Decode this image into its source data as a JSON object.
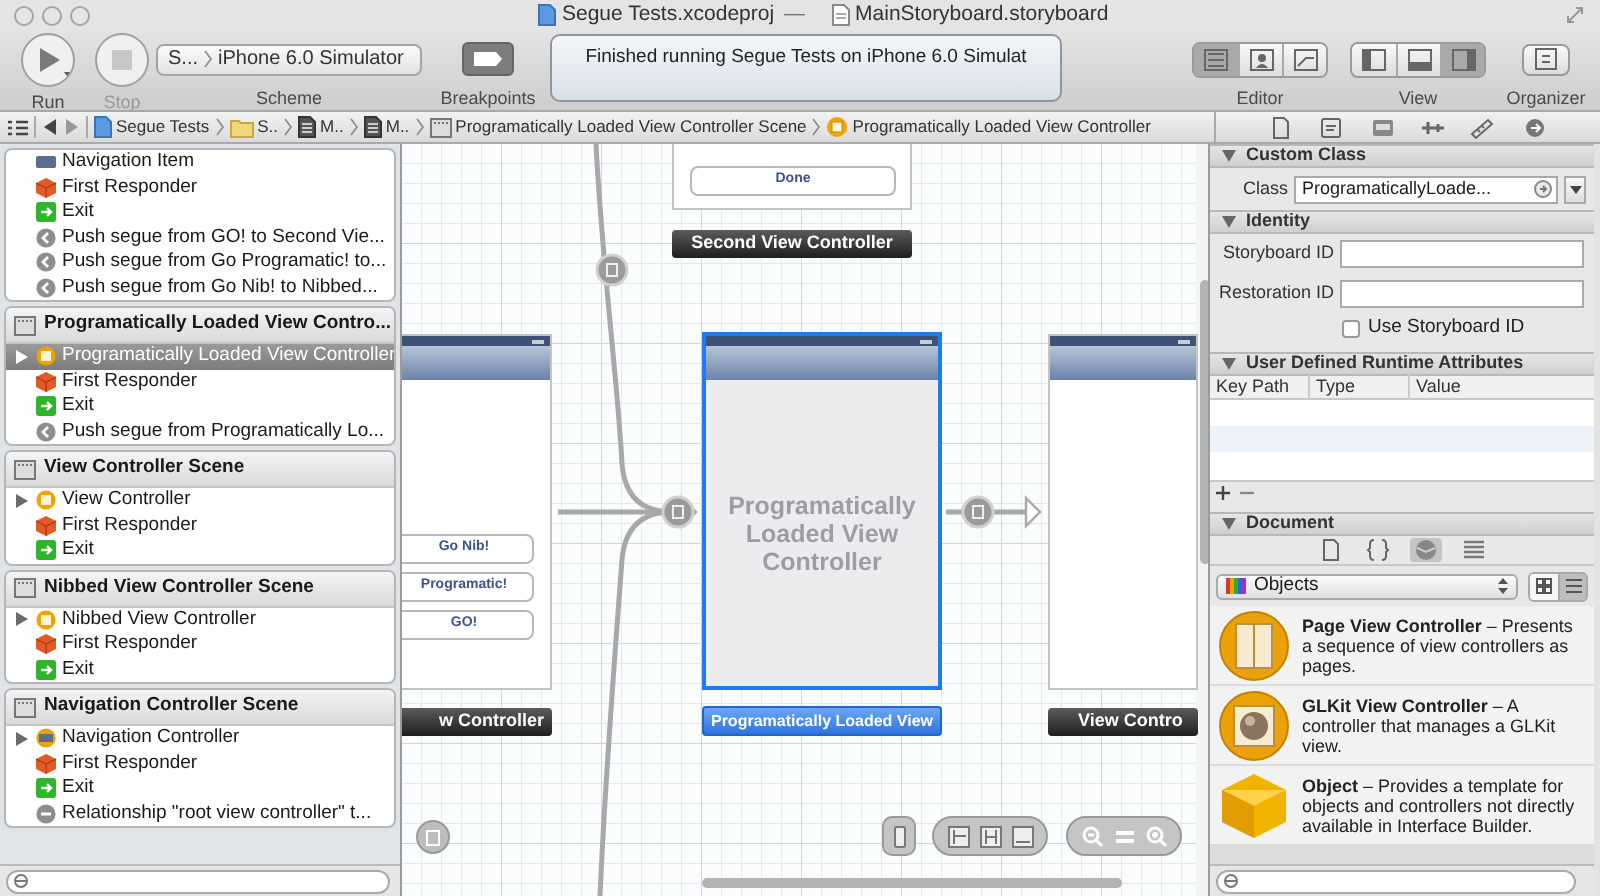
{
  "window": {
    "project_title": "Segue Tests.xcodeproj",
    "separator": "—",
    "document_title": "MainStoryboard.storyboard"
  },
  "toolbar": {
    "run": {
      "label": "Run",
      "disabled": false
    },
    "stop": {
      "label": "Stop",
      "disabled": true
    },
    "scheme": {
      "label": "Scheme",
      "target": "S...",
      "destination": "iPhone 6.0 Simulator"
    },
    "breakpoints": {
      "label": "Breakpoints"
    },
    "activity": "Finished running Segue Tests on iPhone 6.0 Simulat",
    "editor": {
      "label": "Editor",
      "modes": [
        {
          "kind": "standard",
          "selected": true
        },
        {
          "kind": "assistant",
          "selected": false
        },
        {
          "kind": "version",
          "selected": false
        }
      ]
    },
    "view": {
      "label": "View",
      "panes": [
        {
          "kind": "navigator",
          "selected": false
        },
        {
          "kind": "debug",
          "selected": false
        },
        {
          "kind": "utilities",
          "selected": true
        }
      ]
    },
    "organizer": {
      "label": "Organizer"
    }
  },
  "jump_bar": [
    {
      "kind": "project",
      "text": "Segue Tests"
    },
    {
      "kind": "folder",
      "text": "S.."
    },
    {
      "kind": "file",
      "text": "M.."
    },
    {
      "kind": "file",
      "text": "M.."
    },
    {
      "kind": "scene",
      "text": "Programatically Loaded View Controller Scene"
    },
    {
      "kind": "controller",
      "text": "Programatically Loaded View Controller"
    }
  ],
  "inspector_tabs": [
    {
      "kind": "file"
    },
    {
      "kind": "quick-help"
    },
    {
      "kind": "identity"
    },
    {
      "kind": "attributes"
    },
    {
      "kind": "size"
    },
    {
      "kind": "connections"
    }
  ],
  "outline": [
    {
      "items": [
        {
          "kind": "navigation-item",
          "label": "Navigation Item",
          "expandable": false,
          "selected": false
        },
        {
          "kind": "first-responder",
          "label": "First Responder",
          "expandable": false,
          "selected": false
        },
        {
          "kind": "exit",
          "label": "Exit",
          "expandable": false,
          "selected": false
        },
        {
          "kind": "segue",
          "label": "Push segue from GO! to Second Vie...",
          "expandable": false,
          "selected": false
        },
        {
          "kind": "segue",
          "label": "Push segue from Go Programatic! to...",
          "expandable": false,
          "selected": false
        },
        {
          "kind": "segue",
          "label": "Push segue from Go Nib! to Nibbed...",
          "expandable": false,
          "selected": false
        }
      ]
    },
    {
      "title": "Programatically Loaded View Contro...",
      "items": [
        {
          "kind": "view-controller",
          "label": "Programatically Loaded View Controller",
          "expandable": true,
          "selected": true
        },
        {
          "kind": "first-responder",
          "label": "First Responder",
          "expandable": false,
          "selected": false
        },
        {
          "kind": "exit",
          "label": "Exit",
          "expandable": false,
          "selected": false
        },
        {
          "kind": "segue",
          "label": "Push segue from Programatically Lo...",
          "expandable": false,
          "selected": false
        }
      ]
    },
    {
      "title": "View Controller Scene",
      "items": [
        {
          "kind": "view-controller",
          "label": "View Controller",
          "expandable": true,
          "selected": false
        },
        {
          "kind": "first-responder",
          "label": "First Responder",
          "expandable": false,
          "selected": false
        },
        {
          "kind": "exit",
          "label": "Exit",
          "expandable": false,
          "selected": false
        }
      ]
    },
    {
      "title": "Nibbed View Controller Scene",
      "items": [
        {
          "kind": "view-controller",
          "label": "Nibbed View Controller",
          "expandable": true,
          "selected": false
        },
        {
          "kind": "first-responder",
          "label": "First Responder",
          "expandable": false,
          "selected": false
        },
        {
          "kind": "exit",
          "label": "Exit",
          "expandable": false,
          "selected": false
        }
      ]
    },
    {
      "title": "Navigation Controller Scene",
      "items": [
        {
          "kind": "navigation-controller",
          "label": "Navigation Controller",
          "expandable": true,
          "selected": false
        },
        {
          "kind": "first-responder",
          "label": "First Responder",
          "expandable": false,
          "selected": false
        },
        {
          "kind": "exit",
          "label": "Exit",
          "expandable": false,
          "selected": false
        },
        {
          "kind": "relationship",
          "label": "Relationship \"root view controller\" t...",
          "expandable": false,
          "selected": false
        }
      ]
    }
  ],
  "canvas": {
    "scenes": [
      {
        "label": "Second View Controller",
        "selected": false,
        "buttons": [
          "Done"
        ]
      },
      {
        "label": "w Controller",
        "selected": false,
        "buttons": [
          "Go Nib!",
          "Programatic!",
          "GO!"
        ]
      },
      {
        "label": "Programatically Loaded View",
        "selected": true,
        "placeholder": "Programatically Loaded View Controller"
      },
      {
        "label": "View Contro",
        "selected": false
      }
    ]
  },
  "inspector": {
    "custom_class": {
      "header": "Custom Class",
      "class_label": "Class",
      "class_value": "ProgramaticallyLoade..."
    },
    "identity": {
      "header": "Identity",
      "storyboard_id_label": "Storyboard ID",
      "restoration_id_label": "Restoration ID",
      "use_storyboard_id": {
        "label": "Use Storyboard ID",
        "checked": false
      }
    },
    "runtime_attributes": {
      "header": "User Defined Runtime Attributes",
      "columns": [
        "Key Path",
        "Type",
        "Value"
      ]
    },
    "document": {
      "header": "Document"
    }
  },
  "library": {
    "tabs": [
      {
        "kind": "file-template",
        "selected": false
      },
      {
        "kind": "code-snippet",
        "selected": false
      },
      {
        "kind": "object",
        "selected": true
      },
      {
        "kind": "media",
        "selected": false
      }
    ],
    "popup": "Objects",
    "view_modes": [
      {
        "kind": "grid",
        "selected": false
      },
      {
        "kind": "list",
        "selected": true
      }
    ],
    "items": [
      {
        "kind": "page-view-controller",
        "text": "**Page View Controller** – Presents a sequence of view controllers as pages."
      },
      {
        "kind": "glkit-view-controller",
        "text": "**GLKit View Controller** – A controller that manages a GLKit view."
      },
      {
        "kind": "object",
        "text": "**Object** – Provides a template for objects and controllers not directly available in Interface Builder."
      }
    ]
  }
}
